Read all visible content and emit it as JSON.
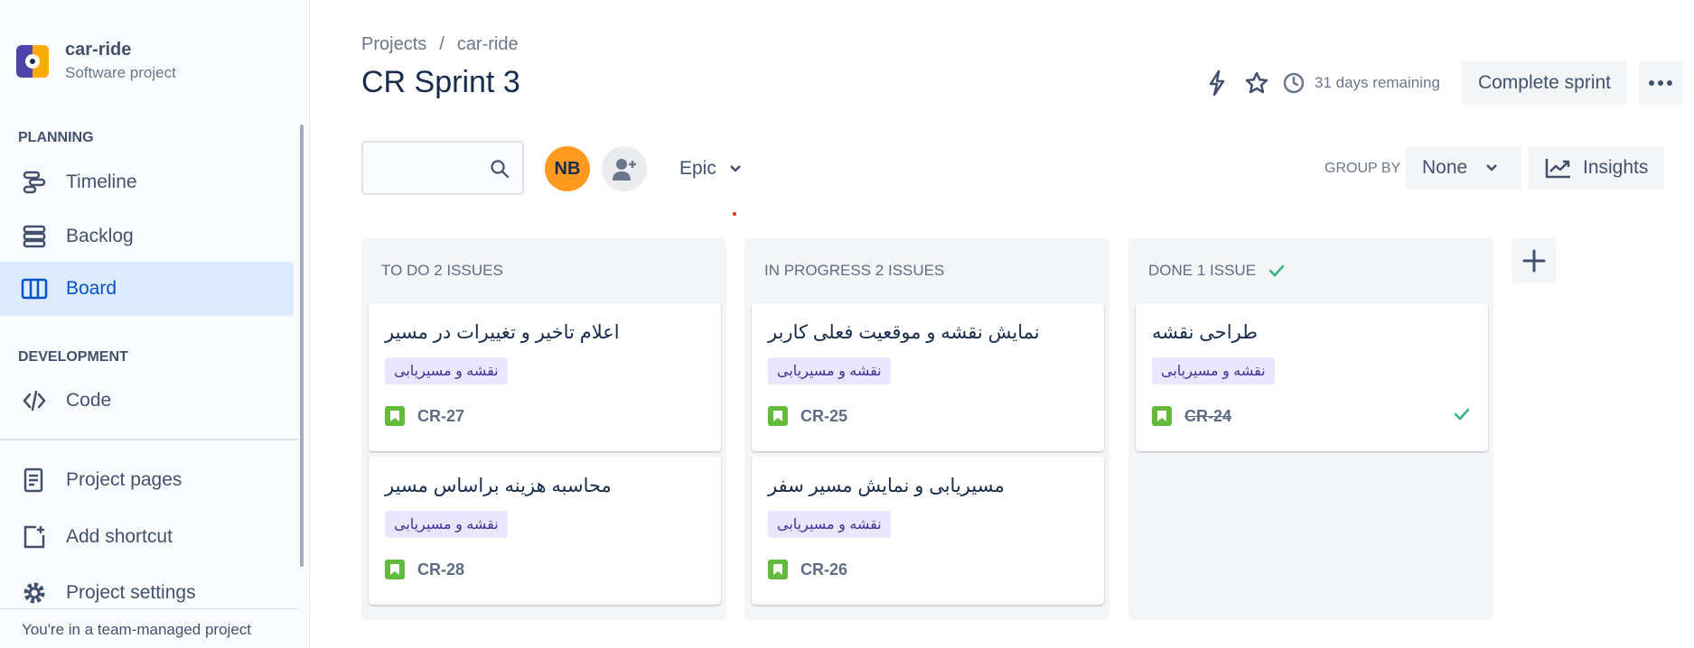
{
  "project": {
    "name": "car-ride",
    "type": "Software project"
  },
  "sidebar": {
    "planning_title": "PLANNING",
    "development_title": "DEVELOPMENT",
    "items": [
      {
        "label": "Timeline",
        "icon": "timeline-icon"
      },
      {
        "label": "Backlog",
        "icon": "backlog-icon"
      },
      {
        "label": "Board",
        "icon": "board-icon",
        "active": true
      },
      {
        "label": "Code",
        "icon": "code-icon"
      },
      {
        "label": "Project pages",
        "icon": "pages-icon"
      },
      {
        "label": "Add shortcut",
        "icon": "add-shortcut-icon"
      },
      {
        "label": "Project settings",
        "icon": "gear-icon"
      }
    ],
    "footer_note": "You're in a team-managed project"
  },
  "breadcrumb": {
    "projects": "Projects",
    "separator": "/",
    "project": "car-ride"
  },
  "title": "CR Sprint 3",
  "actions": {
    "remaining": "31 days remaining",
    "complete_sprint": "Complete sprint"
  },
  "filters": {
    "search_placeholder": "",
    "avatar_initials": "NB",
    "epic_label": "Epic",
    "groupby_label": "GROUP BY",
    "groupby_value": "None",
    "insights_label": "Insights"
  },
  "columns": [
    {
      "header": "TO DO 2 ISSUES",
      "cards": [
        {
          "title": "اعلام تاخیر و تغییرات در مسیر",
          "epic": "نقشه و مسیریابی",
          "key": "CR-27"
        },
        {
          "title": "محاسبه هزینه براساس مسیر",
          "epic": "نقشه و مسیریابی",
          "key": "CR-28"
        }
      ]
    },
    {
      "header": "IN PROGRESS 2 ISSUES",
      "cards": [
        {
          "title": "نمایش نقشه و موقعیت فعلی کاربر",
          "epic": "نقشه و مسیریابی",
          "key": "CR-25"
        },
        {
          "title": "مسیریابی و نمایش مسیر سفر",
          "epic": "نقشه و مسیریابی",
          "key": "CR-26"
        }
      ]
    },
    {
      "header": "DONE 1 ISSUE",
      "cards": [
        {
          "title": "طراحی نقشه",
          "epic": "نقشه و مسیریابی",
          "key": "CR-24",
          "done": true
        }
      ]
    }
  ],
  "colors": {
    "accent": "#0052cc",
    "active_bg": "#deebff",
    "epic_bg": "#eae6ff",
    "epic_text": "#403294",
    "story_green": "#63ba3c",
    "done_green": "#36b37e",
    "avatar_orange": "#ff991f"
  }
}
